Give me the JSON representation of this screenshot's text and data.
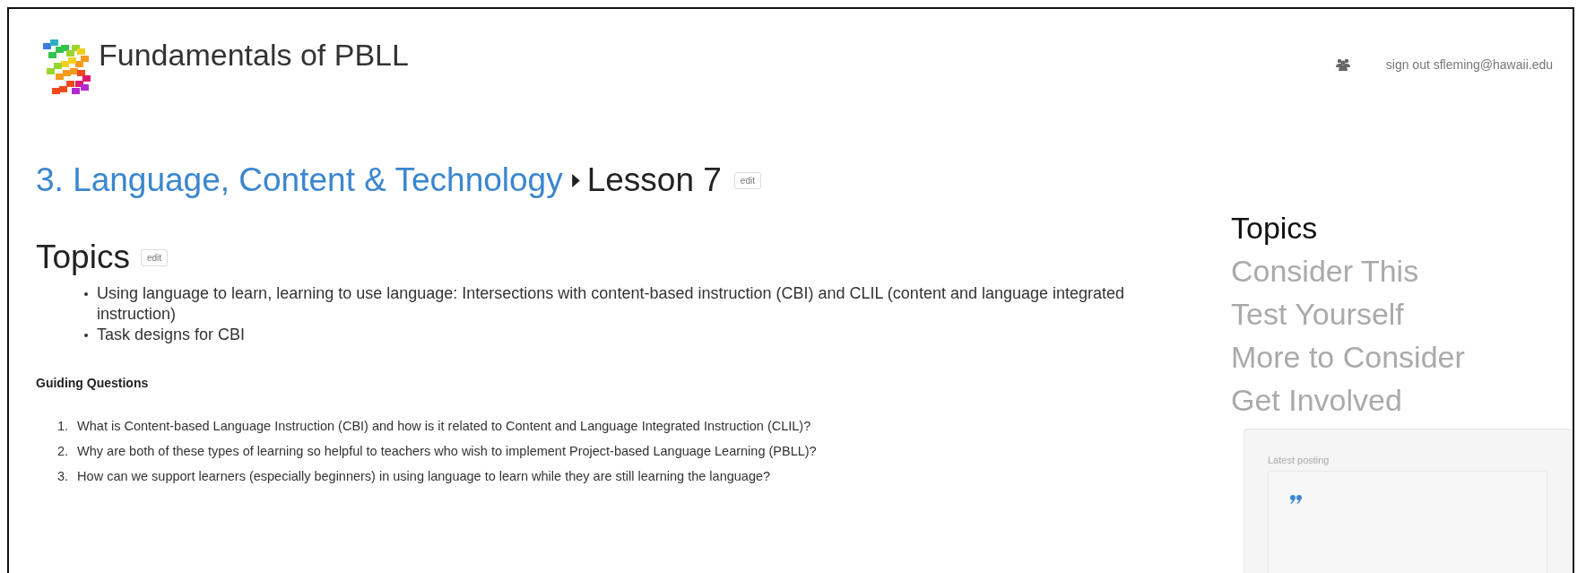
{
  "header": {
    "title": "Fundamentals of PBLL",
    "account_link": "sign out sfleming@hawaii.edu"
  },
  "breadcrumb": {
    "parent": "3. Language, Content & Technology",
    "current": "Lesson 7",
    "edit_label": "edit"
  },
  "topics": {
    "heading": "Topics",
    "edit_label": "edit",
    "items": [
      "Using language to learn, learning to use language: Intersections with content-based instruction (CBI) and CLIL (content and language integrated instruction)",
      "Task designs for CBI"
    ]
  },
  "guiding_questions": {
    "heading": "Guiding Questions",
    "items": [
      {
        "number": "1.",
        "text": "What is Content-based Language Instruction (CBI) and how is it related to Content and Language Integrated Instruction (CLIL)?"
      },
      {
        "number": "2.",
        "text": "Why are both of these types of learning so helpful to teachers who wish to implement Project-based Language Learning (PBLL)?"
      },
      {
        "number": "3.",
        "text": "How can we support learners (especially beginners) in using language to learn while they are still learning the language?"
      }
    ]
  },
  "sidebar": {
    "items": [
      {
        "label": "Topics",
        "selected": true
      },
      {
        "label": "Consider This",
        "selected": false
      },
      {
        "label": "Test Yourself",
        "selected": false
      },
      {
        "label": "More to Consider",
        "selected": false
      },
      {
        "label": "Get Involved",
        "selected": false
      }
    ],
    "latest_posting": {
      "label": "Latest posting"
    }
  }
}
